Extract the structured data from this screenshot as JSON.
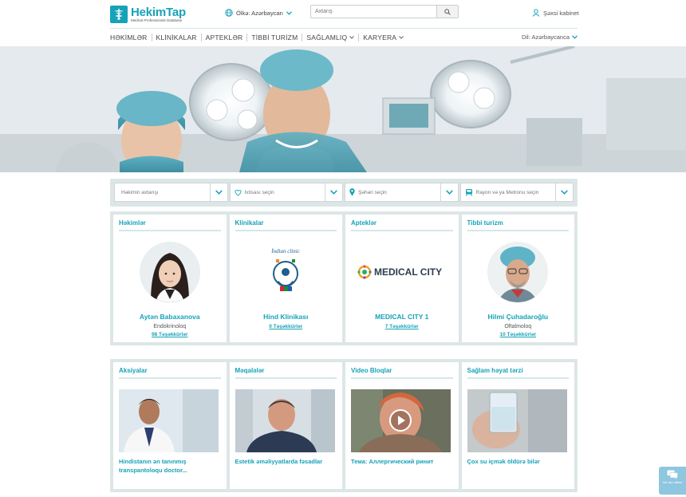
{
  "header": {
    "logo_title": "HekimTap",
    "logo_subtitle": "Medical Professionals Database",
    "country_label": "Ölkə: Azərbaycan",
    "search_placeholder": "Axtarış",
    "cabinet_label": "Şəxsi kabinet",
    "language_label": "Dil: Azərbaycanca"
  },
  "nav": {
    "items": [
      {
        "label": "HƏKİMLƏR"
      },
      {
        "label": "KLİNİKALAR"
      },
      {
        "label": "APTEKLƏR"
      },
      {
        "label": "TİBBİ TURİZM"
      },
      {
        "label": "SAĞLAMLIQ"
      },
      {
        "label": "KARYERA"
      }
    ]
  },
  "filters": [
    {
      "placeholder": "Həkimin axtarışı",
      "icon": "none"
    },
    {
      "placeholder": "İxtisası seçin",
      "icon": "specialty-icon"
    },
    {
      "placeholder": "Şəhəri seçin",
      "icon": "location-pin-icon"
    },
    {
      "placeholder": "Rayon və ya Metronu seçin",
      "icon": "metro-icon"
    }
  ],
  "cards_row1": [
    {
      "title": "Həkimlər",
      "name": "Aytən Babaxanova",
      "spec": "Endokrinoloq",
      "thanks": "98 Təşəkkürlər"
    },
    {
      "title": "Klinikalar",
      "name": "Hind Klinikası",
      "spec": "",
      "thanks": "0 Təşəkkürlər",
      "logo_text": "İndian clinic"
    },
    {
      "title": "Apteklər",
      "name": "MEDICAL CITY 1",
      "spec": "",
      "thanks": "7 Təşəkkürlər",
      "logo_text": "MEDICAL CITY"
    },
    {
      "title": "Tibbi turizm",
      "name": "Hilmi Çuhadaroğlu",
      "spec": "Oftalmoloq",
      "thanks": "10 Təşəkkürlər"
    }
  ],
  "cards_row2": [
    {
      "title": "Aksiyalar",
      "text": "Hindistanın ən tanınmış transpantoloqu doctor..."
    },
    {
      "title": "Məqalələr",
      "text": "Estetik əməliyyatlarda fəsadlar"
    },
    {
      "title": "Video Bloqlar",
      "text": "Тема: Аллергический ринит"
    },
    {
      "title": "Sağlam həyat tərzi",
      "text": "Çox su içmək öldürə bilər"
    }
  ],
  "chat": {
    "label": "We are offline"
  },
  "colors": {
    "accent": "#17a2b8",
    "panel": "#dde6e7"
  }
}
